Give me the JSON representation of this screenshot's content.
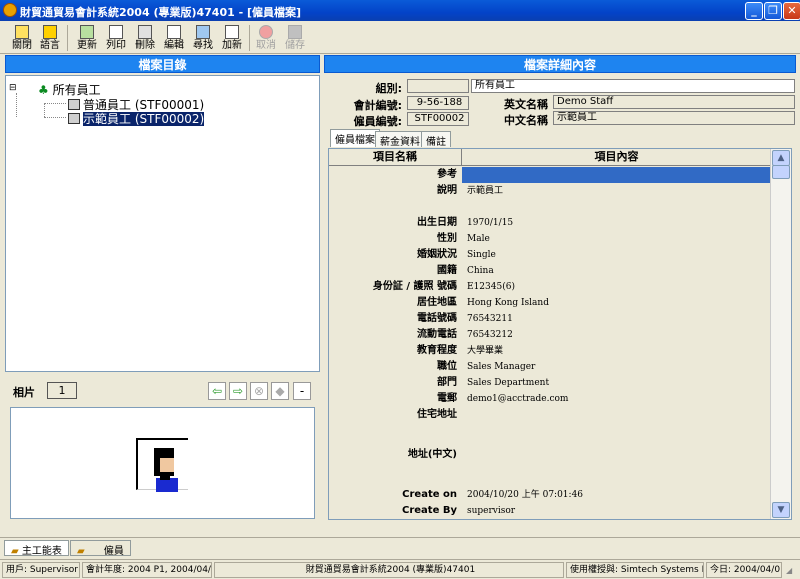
{
  "window": {
    "title": "財貿通貿易會計系統2004 (專業版)47401  - [僱員檔案]",
    "buttons": {
      "minimize": "_",
      "restore": "❐",
      "close": "✕"
    }
  },
  "toolbar": {
    "items": [
      {
        "label": "關閉",
        "icon": "close-door-icon"
      },
      {
        "label": "語言",
        "icon": "language-icon"
      },
      {
        "label": "更新",
        "icon": "refresh-icon"
      },
      {
        "label": "列印",
        "icon": "print-icon"
      },
      {
        "label": "刪除",
        "icon": "delete-icon"
      },
      {
        "label": "編輯",
        "icon": "edit-icon"
      },
      {
        "label": "尋找",
        "icon": "find-icon"
      },
      {
        "label": "加新",
        "icon": "new-icon"
      },
      {
        "label": "取消",
        "icon": "cancel-icon"
      },
      {
        "label": "儲存",
        "icon": "save-icon"
      }
    ]
  },
  "left": {
    "header": "檔案目錄",
    "tree": {
      "root": "所有員工",
      "items": [
        "普通員工 (STF00001)",
        "示範員工 (STF00002)"
      ]
    },
    "photo": {
      "label": "相片",
      "index": "1",
      "minus": "-"
    }
  },
  "right": {
    "header": "檔案詳細內容",
    "fields": {
      "group_label": "組別:",
      "group_value": "所有員工",
      "account_label": "會計編號:",
      "account_value": "9-56-188",
      "staff_label": "僱員編號:",
      "staff_value": "STF00002",
      "en_name_label": "英文名稱",
      "en_name_value": "Demo Staff",
      "zh_name_label": "中文名稱",
      "zh_name_value": "示範員工"
    },
    "tabs": [
      "僱員檔案",
      "薪金資料",
      "備註"
    ],
    "grid": {
      "col_name": "項目名稱",
      "col_content": "項目內容",
      "rows": [
        {
          "k": "參考",
          "v": ""
        },
        {
          "k": "說明",
          "v": "示範員工"
        },
        {
          "k": "出生日期",
          "v": "1970/1/15"
        },
        {
          "k": "性別",
          "v": "Male"
        },
        {
          "k": "婚姻狀況",
          "v": "Single"
        },
        {
          "k": "國籍",
          "v": "China"
        },
        {
          "k": "身份証 / 護照 號碼",
          "v": "E12345(6)"
        },
        {
          "k": "居住地區",
          "v": "Hong Kong Island"
        },
        {
          "k": "電話號碼",
          "v": "76543211"
        },
        {
          "k": "流動電話",
          "v": "76543212"
        },
        {
          "k": "教育程度",
          "v": "大學畢業"
        },
        {
          "k": "職位",
          "v": "Sales Manager"
        },
        {
          "k": "部門",
          "v": "Sales Department"
        },
        {
          "k": "電郵",
          "v": "demo1@acctrade.com"
        },
        {
          "k": "住宅地址",
          "v": ""
        },
        {
          "k": "地址(中文)",
          "v": ""
        },
        {
          "k": "Create on",
          "v": "2004/10/20 上午 07:01:46"
        },
        {
          "k": "Create By",
          "v": "supervisor"
        }
      ]
    }
  },
  "bottom_tabs": [
    "主工能表",
    "僱員"
  ],
  "status": {
    "user": "用戶: Supervisor",
    "period": "會計年度: 2004 P1, 2004/04/01",
    "app": "財貿通貿易會計系統2004 (專業版)47401",
    "license": "使用權授與: Simtech Systems Ltd.",
    "today": "今日: 2004/04/01"
  }
}
